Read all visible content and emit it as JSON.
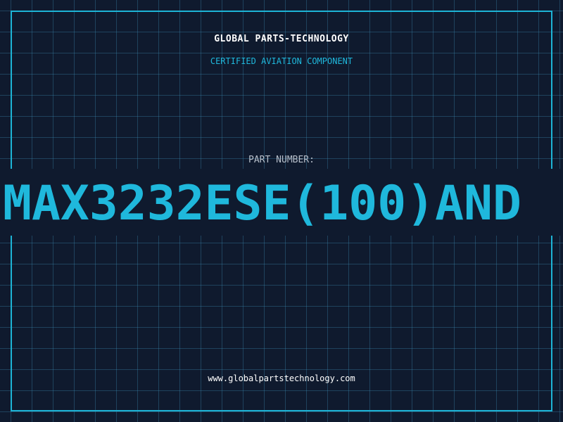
{
  "header": {
    "company": "GLOBAL PARTS-TECHNOLOGY",
    "tagline": "CERTIFIED AVIATION COMPONENT"
  },
  "part": {
    "label": "PART NUMBER:",
    "number": "MAX3232ESE(100)AND"
  },
  "footer": {
    "website": "www.globalpartstechnology.com"
  },
  "colors": {
    "background": "#0f1a2e",
    "accent": "#1fb8dc",
    "grid": "#2a5a78",
    "text": "#ffffff",
    "label": "#b6bec9"
  }
}
